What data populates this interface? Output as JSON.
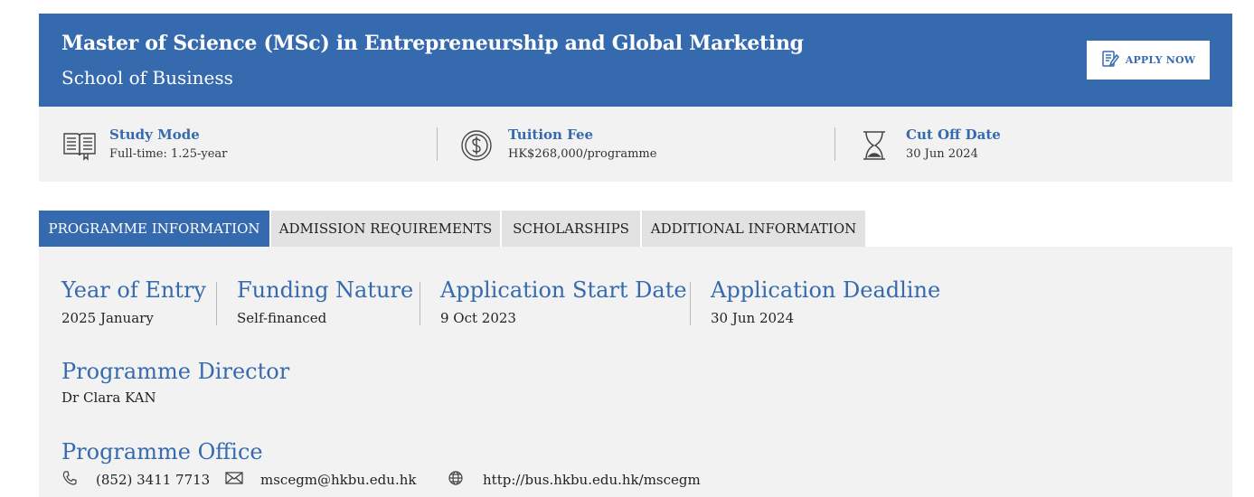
{
  "header": {
    "title": "Master of Science (MSc) in Entrepreneurship and Global Marketing",
    "subtitle": "School of Business",
    "apply_label": "APPLY NOW"
  },
  "summary": [
    {
      "icon": "open-book-icon",
      "title": "Study Mode",
      "value": "Full-time: 1.25-year"
    },
    {
      "icon": "dollar-coin-icon",
      "title": "Tuition Fee",
      "value": "HK$268,000/programme"
    },
    {
      "icon": "hourglass-icon",
      "title": "Cut Off Date",
      "value": "30 Jun 2024"
    }
  ],
  "tabs": [
    {
      "label": "PROGRAMME INFORMATION",
      "active": true
    },
    {
      "label": "ADMISSION REQUIREMENTS",
      "active": false
    },
    {
      "label": "SCHOLARSHIPS",
      "active": false
    },
    {
      "label": "ADDITIONAL INFORMATION",
      "active": false
    }
  ],
  "programme_info": {
    "fields": [
      {
        "label": "Year of Entry",
        "value": "2025 January"
      },
      {
        "label": "Funding Nature",
        "value": "Self-financed"
      },
      {
        "label": "Application Start Date",
        "value": "9 Oct 2023"
      },
      {
        "label": "Application Deadline",
        "value": "30 Jun 2024"
      }
    ],
    "director": {
      "label": "Programme Director",
      "value": "Dr Clara KAN"
    },
    "office": {
      "label": "Programme Office",
      "phone": "(852) 3411 7713",
      "email": "mscegm@hkbu.edu.hk",
      "website": "http://bus.hkbu.edu.hk/mscegm"
    }
  },
  "colors": {
    "accent": "#356aaf",
    "panel_bg": "#f2f2f2",
    "tab_bg": "#e2e2e2"
  }
}
